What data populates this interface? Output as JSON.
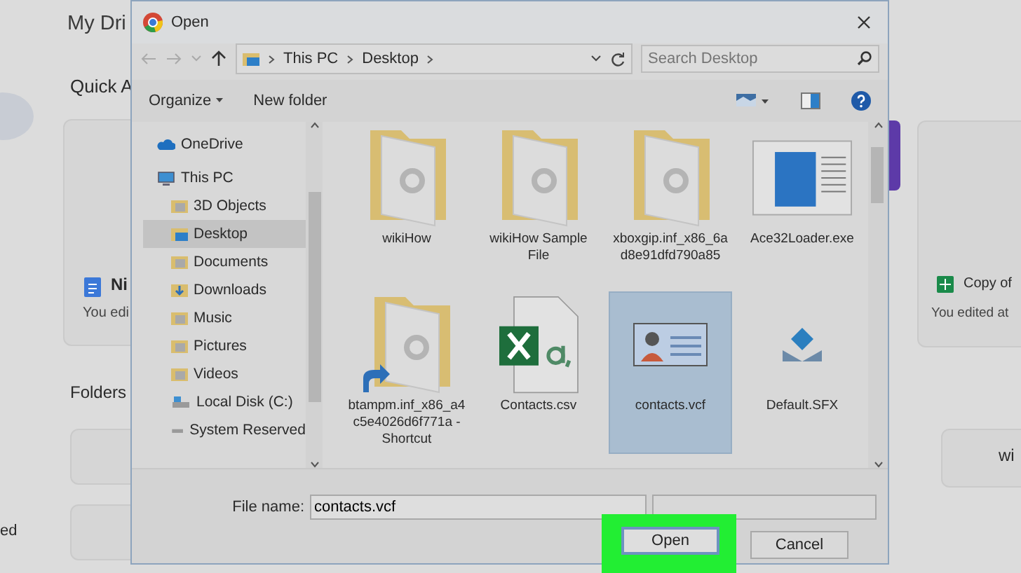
{
  "background_page": {
    "title": "My Dri",
    "section": "Quick A",
    "left_card": {
      "name": "Ni",
      "edited": "You edi"
    },
    "folders_heading": "Folders",
    "left_fragment": "ed",
    "right_card": {
      "name": "Copy of",
      "edited": "You edited at"
    },
    "right_folder": "wi"
  },
  "dialog": {
    "title": "Open",
    "address": {
      "path": [
        "This PC",
        "Desktop"
      ],
      "search_placeholder": "Search Desktop"
    },
    "toolbar": {
      "organize": "Organize",
      "new_folder": "New folder"
    },
    "nav": [
      {
        "label": "OneDrive",
        "kind": "cloud",
        "selected": false
      },
      {
        "label": "This PC",
        "kind": "pc",
        "selected": false,
        "children": [
          {
            "label": "3D Objects",
            "kind": "folder",
            "selected": false
          },
          {
            "label": "Desktop",
            "kind": "desktop",
            "selected": true
          },
          {
            "label": "Documents",
            "kind": "folder",
            "selected": false
          },
          {
            "label": "Downloads",
            "kind": "download",
            "selected": false
          },
          {
            "label": "Music",
            "kind": "folder",
            "selected": false
          },
          {
            "label": "Pictures",
            "kind": "folder",
            "selected": false
          },
          {
            "label": "Videos",
            "kind": "folder",
            "selected": false
          },
          {
            "label": "Local Disk (C:)",
            "kind": "disk",
            "selected": false
          },
          {
            "label": "System Reserved",
            "kind": "drive",
            "selected": false
          }
        ]
      }
    ],
    "files": [
      {
        "name": "wikiHow",
        "kind": "folder",
        "selected": false
      },
      {
        "name": "wikiHow Sample File",
        "kind": "folder",
        "selected": false
      },
      {
        "name": "xboxgip.inf_x86_6ad8e91dfd790a85",
        "kind": "folder",
        "selected": false
      },
      {
        "name": "Ace32Loader.exe",
        "kind": "exe",
        "selected": false
      },
      {
        "name": "btampm.inf_x86_a4c5e4026d6f771a - Shortcut",
        "kind": "shortcut",
        "selected": false
      },
      {
        "name": "Contacts.csv",
        "kind": "csv",
        "selected": false
      },
      {
        "name": "contacts.vcf",
        "kind": "vcf",
        "selected": true
      },
      {
        "name": "Default.SFX",
        "kind": "sfx",
        "selected": false
      }
    ],
    "file_name_label": "File name:",
    "file_name": "contacts.vcf",
    "buttons": [
      {
        "label": "Open",
        "kind": "primary",
        "highlighted": true
      },
      {
        "label": "Cancel",
        "kind": "normal",
        "highlighted": false
      }
    ]
  }
}
